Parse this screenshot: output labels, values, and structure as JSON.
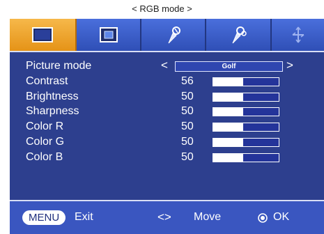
{
  "caption": "< RGB mode >",
  "tabs": [
    {
      "icon": "picture-icon",
      "active": true
    },
    {
      "icon": "screen-icon",
      "active": false
    },
    {
      "icon": "tool-icon",
      "active": false
    },
    {
      "icon": "tools-icon",
      "active": false
    },
    {
      "icon": "move-arrows-icon",
      "active": false
    }
  ],
  "picture_mode": {
    "label": "Picture mode",
    "arrow_left": "<",
    "arrow_right": ">",
    "value": "Golf"
  },
  "settings": [
    {
      "label": "Contrast",
      "value": "56",
      "level": 0.46
    },
    {
      "label": "Brightness",
      "value": "50",
      "level": 0.46
    },
    {
      "label": "Sharpness",
      "value": "50",
      "level": 0.46
    },
    {
      "label": "Color R",
      "value": "50",
      "level": 0.46
    },
    {
      "label": "Color G",
      "value": "50",
      "level": 0.46
    },
    {
      "label": "Color B",
      "value": "50",
      "level": 0.46
    }
  ],
  "footer": {
    "menu_key": "MENU",
    "exit_label": "Exit",
    "move_key": "<>",
    "move_label": "Move",
    "ok_label": "OK"
  },
  "colors": {
    "panel": "#2d3f8e",
    "tab_active": "#f0a22c",
    "tab_inactive": "#3a5cc6",
    "bar_fill": "#ffffff"
  }
}
